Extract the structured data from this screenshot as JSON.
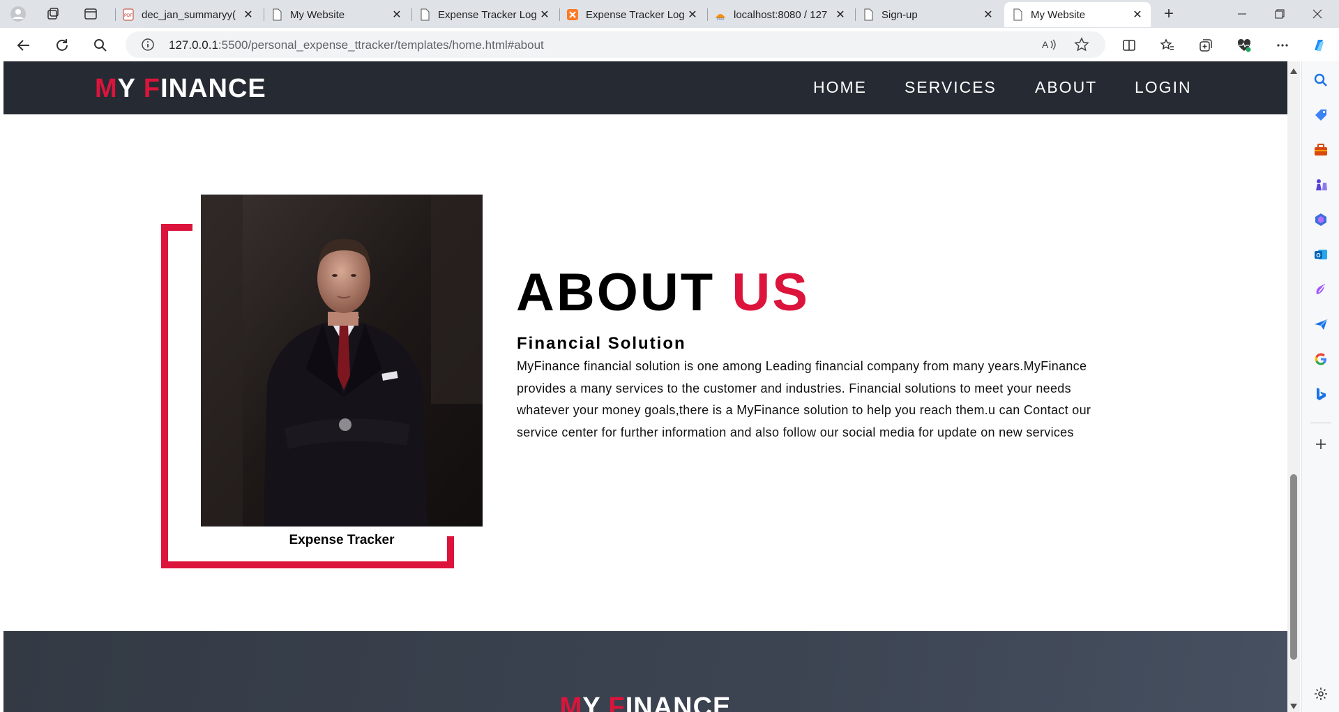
{
  "browser": {
    "tabs": [
      {
        "title": "dec_jan_summaryy(",
        "icon": "pdf-file-icon",
        "active": false
      },
      {
        "title": "My Website",
        "icon": "page-icon",
        "active": false
      },
      {
        "title": "Expense Tracker Log",
        "icon": "page-icon",
        "active": false
      },
      {
        "title": "Expense Tracker Log",
        "icon": "xampp-icon",
        "active": false
      },
      {
        "title": "localhost:8080 / 127",
        "icon": "phpmyadmin-icon",
        "active": false
      },
      {
        "title": "Sign-up",
        "icon": "page-icon",
        "active": false
      },
      {
        "title": "My Website",
        "icon": "page-icon",
        "active": true
      }
    ],
    "url_host": "127.0.0.1",
    "url_rest": ":5500/personal_expense_ttracker/templates/home.html#about"
  },
  "site": {
    "brand": {
      "first_initial": "M",
      "first_rest": "Y ",
      "second_initial": "F",
      "second_rest": "INANCE"
    },
    "nav": [
      "HOME",
      "SERVICES",
      "ABOUT",
      "LOGIN"
    ],
    "about": {
      "title_black": "ABOUT ",
      "title_red": "US",
      "subtitle": "Financial Solution",
      "paragraph": "MyFinance financial solution is one among Leading financial company from many years.MyFinance provides a many services to the customer and industries. Financial solutions to meet your needs whatever your money goals,there is a MyFinance solution to help you reach them.u can Contact our service center for further information and also follow our social media for update on new services",
      "photo_caption": "Expense Tracker"
    },
    "footer_brand": {
      "first_initial": "M",
      "first_rest": "Y ",
      "second_initial": "F",
      "second_rest": "INANCE"
    }
  },
  "colors": {
    "accent": "#dc143c",
    "nav_bg": "#262b33",
    "footer_bg": "#3c4452"
  }
}
